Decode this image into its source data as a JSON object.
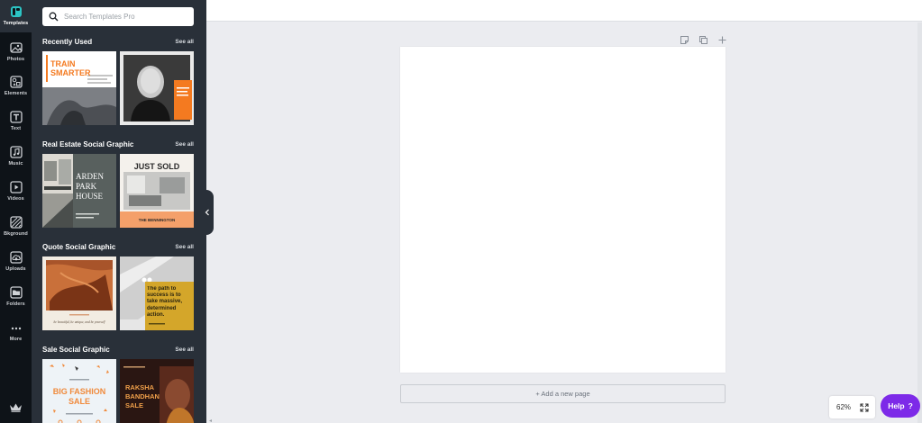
{
  "rail": {
    "items": [
      {
        "label": "Templates",
        "icon": "templates-icon"
      },
      {
        "label": "Photos",
        "icon": "photos-icon"
      },
      {
        "label": "Elements",
        "icon": "elements-icon"
      },
      {
        "label": "Text",
        "icon": "text-icon"
      },
      {
        "label": "Music",
        "icon": "music-icon"
      },
      {
        "label": "Videos",
        "icon": "videos-icon"
      },
      {
        "label": "Bkground",
        "icon": "background-icon"
      },
      {
        "label": "Uploads",
        "icon": "uploads-icon"
      },
      {
        "label": "Folders",
        "icon": "folders-icon"
      },
      {
        "label": "More",
        "icon": "more-icon"
      }
    ]
  },
  "search": {
    "placeholder": "Search Templates Pro"
  },
  "sections": [
    {
      "title": "Recently Used",
      "see_all": "See all",
      "thumbs": [
        {
          "text_1": "TRAIN",
          "text_2": "SMARTER"
        },
        {}
      ]
    },
    {
      "title": "Real Estate Social Graphic",
      "see_all": "See all",
      "thumbs": [
        {
          "text_1": "ARDEN",
          "text_2": "PARK",
          "text_3": "HOUSE"
        },
        {
          "text_1": "JUST SOLD",
          "text_2": "THE BENNINGTON"
        }
      ]
    },
    {
      "title": "Quote Social Graphic",
      "see_all": "See all",
      "thumbs": [
        {
          "text_1": "be beautiful, be unique, and be yourself"
        },
        {
          "text_1": "The path to success is to take massive, determined action."
        }
      ]
    },
    {
      "title": "Sale Social Graphic",
      "see_all": "See all",
      "thumbs": [
        {
          "text_1": "BIG FASHION",
          "text_2": "SALE"
        },
        {
          "text_1": "RAKSHA",
          "text_2": "BANDHAN",
          "text_3": "SALE"
        }
      ]
    }
  ],
  "canvas": {
    "add_page": "+ Add a new page"
  },
  "zoom": {
    "level": "62%"
  },
  "help": {
    "label": "Help",
    "glyph": "?"
  },
  "colors": {
    "accent": "#7d2ae8",
    "panel": "#293039",
    "rail": "#0e1318"
  }
}
